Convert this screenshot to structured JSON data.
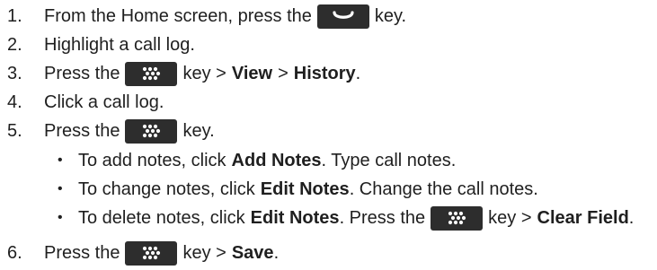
{
  "steps": [
    {
      "num": "1.",
      "pre": "From the Home screen, press the",
      "key": "end-call-key-icon",
      "post": "key."
    },
    {
      "num": "2.",
      "text": "Highlight a call log."
    },
    {
      "num": "3.",
      "pre": "Press the",
      "key": "menu-key-icon",
      "mid": "key >",
      "b1": "View",
      "sep": ">",
      "b2": "History",
      "end": "."
    },
    {
      "num": "4.",
      "text": "Click a call log."
    },
    {
      "num": "5.",
      "pre": "Press the",
      "key": "menu-key-icon",
      "post": "key."
    },
    {
      "num": "6.",
      "pre": "Press the",
      "key": "menu-key-icon",
      "mid": "key >",
      "b1": "Save",
      "end": "."
    }
  ],
  "bullets": [
    {
      "dot": "•",
      "pre": "To add notes, click",
      "b1": "Add Notes",
      "post": ". Type call notes."
    },
    {
      "dot": "•",
      "pre": "To change notes, click",
      "b1": "Edit Notes",
      "post": ". Change the call notes."
    },
    {
      "dot": "•",
      "pre": "To delete notes, click",
      "b1": "Edit Notes",
      "post": ". Press the",
      "key": "menu-key-icon",
      "mid": "key >",
      "b2": "Clear Field",
      "end": "."
    }
  ],
  "colors": {
    "text": "#1f1f1f",
    "keycap": "#2d2d2d",
    "glyph": "#ffffff"
  }
}
